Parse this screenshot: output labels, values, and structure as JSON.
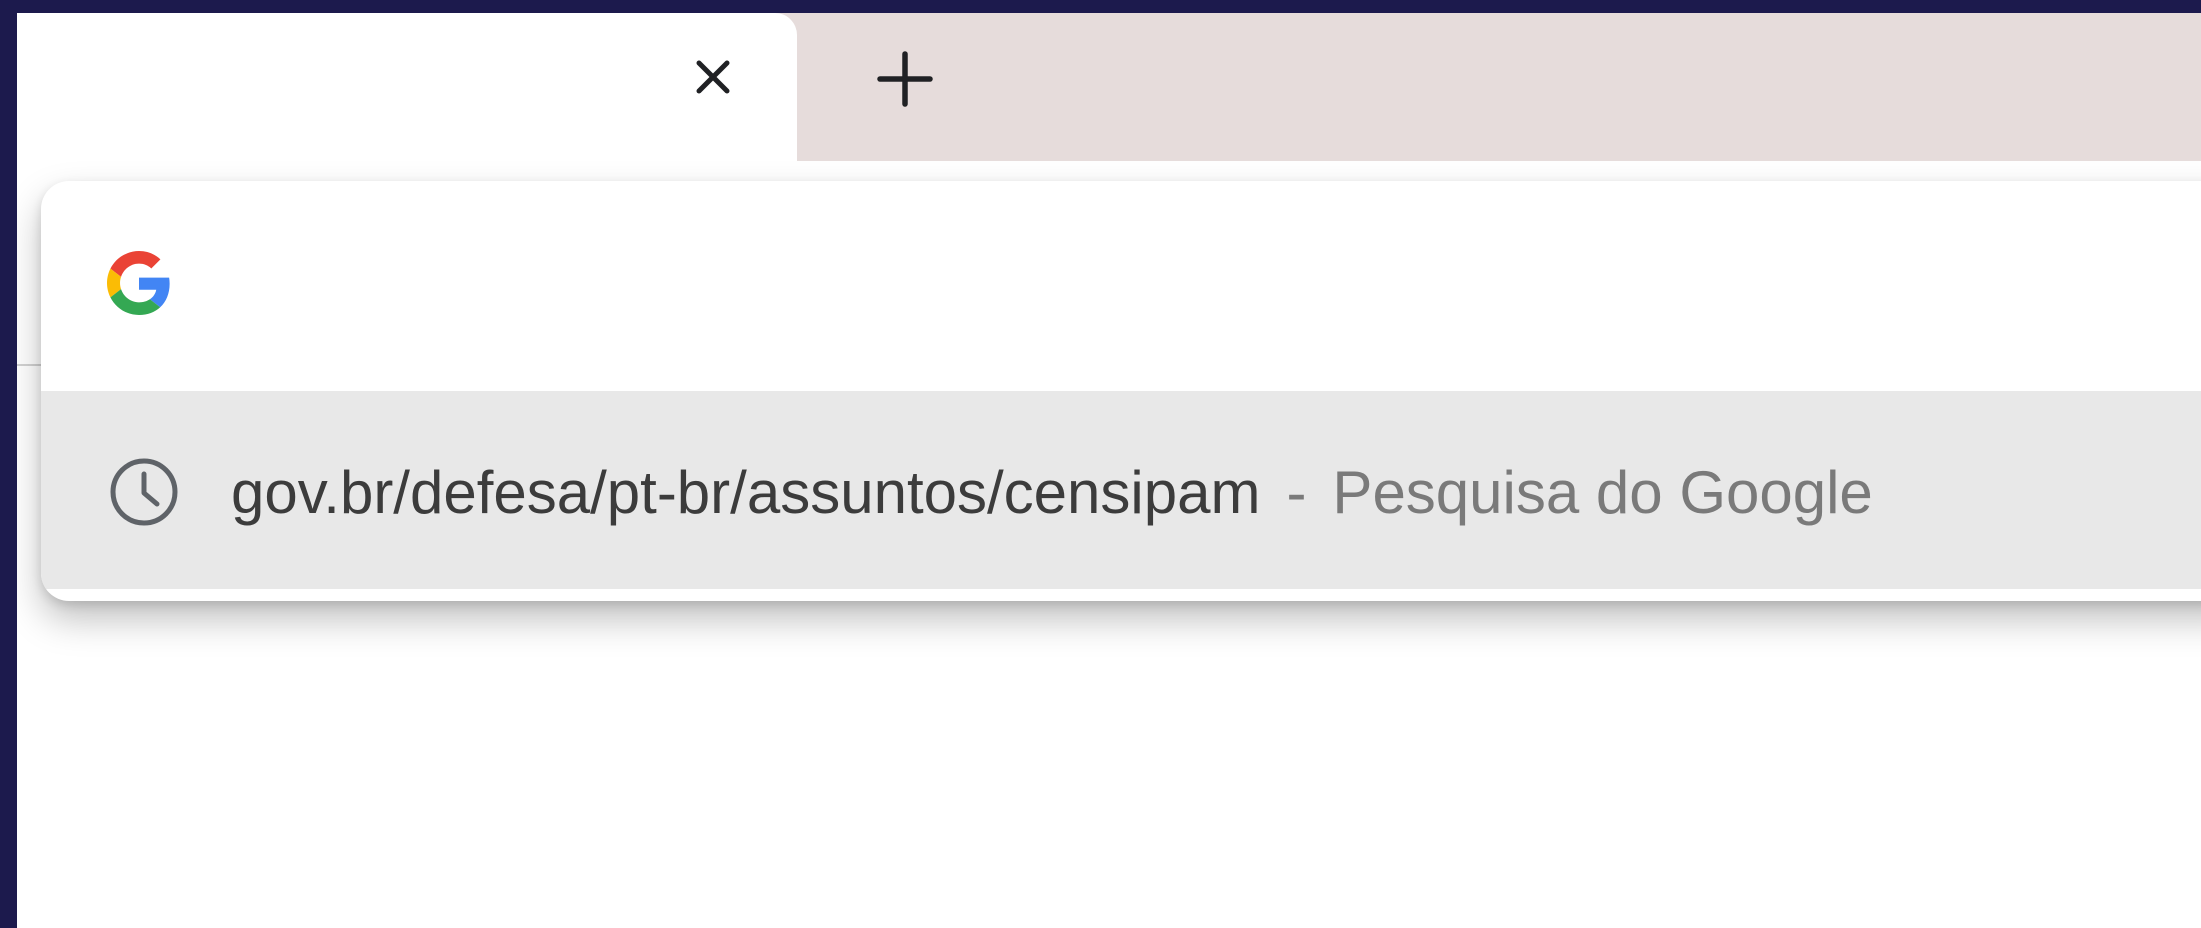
{
  "tab_bar": {
    "close_icon": "close-icon",
    "new_tab_icon": "plus-icon"
  },
  "omnibox": {
    "icon": "google-g-icon",
    "input_value": "",
    "suggestions": [
      {
        "icon": "history-clock-icon",
        "query": "gov.br/defesa/pt-br/assuntos/censipam",
        "separator": "-",
        "description": "Pesquisa do Google"
      }
    ]
  },
  "colors": {
    "frame_background": "#1c1a4d",
    "tab_strip": "#e6dcdb",
    "active_tab": "#ffffff",
    "suggestion_highlight": "#e8e8e8",
    "google_blue": "#4285f4",
    "google_red": "#ea4335",
    "google_yellow": "#fbbc05",
    "google_green": "#34a853"
  }
}
